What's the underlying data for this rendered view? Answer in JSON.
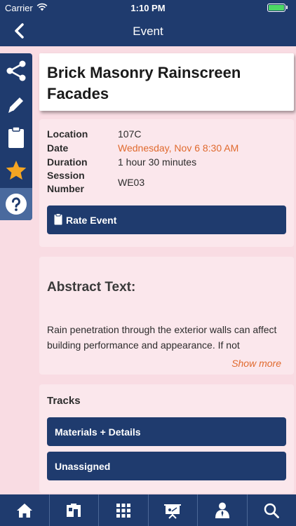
{
  "status_bar": {
    "carrier": "Carrier",
    "time": "1:10 PM",
    "battery_level": 1.0
  },
  "nav": {
    "title": "Event",
    "back_icon": "chevron-left-icon"
  },
  "side_toolbar": {
    "items": [
      {
        "icon": "share-icon"
      },
      {
        "icon": "pencil-icon"
      },
      {
        "icon": "clipboard-icon"
      },
      {
        "icon": "star-icon",
        "color": "#f5a623"
      },
      {
        "icon": "help-icon"
      }
    ]
  },
  "event": {
    "title": "Brick Masonry Rainscreen Facades",
    "details": [
      {
        "label": "Location",
        "value": "107C"
      },
      {
        "label": "Date",
        "value": "Wednesday, Nov 6 8:30 AM"
      },
      {
        "label": "Duration",
        "value": "1 hour 30 minutes"
      },
      {
        "label": "Session Number",
        "value": "WE03"
      }
    ],
    "rate_label": "Rate Event"
  },
  "abstract": {
    "heading": "Abstract Text:",
    "text": "Rain penetration through the exterior walls can affect building performance and appearance. If not",
    "show_more": "Show more"
  },
  "tracks": {
    "heading": "Tracks",
    "items": [
      "Materials + Details",
      "Unassigned"
    ]
  },
  "tab_bar": {
    "items": [
      {
        "icon": "home-icon"
      },
      {
        "icon": "booth-icon"
      },
      {
        "icon": "grid-icon"
      },
      {
        "icon": "presentation-icon"
      },
      {
        "icon": "person-icon"
      },
      {
        "icon": "search-icon"
      }
    ]
  },
  "colors": {
    "primary": "#1f3b6e",
    "accent": "#e06a2e",
    "background": "#f9dce3",
    "star": "#f5a623"
  }
}
